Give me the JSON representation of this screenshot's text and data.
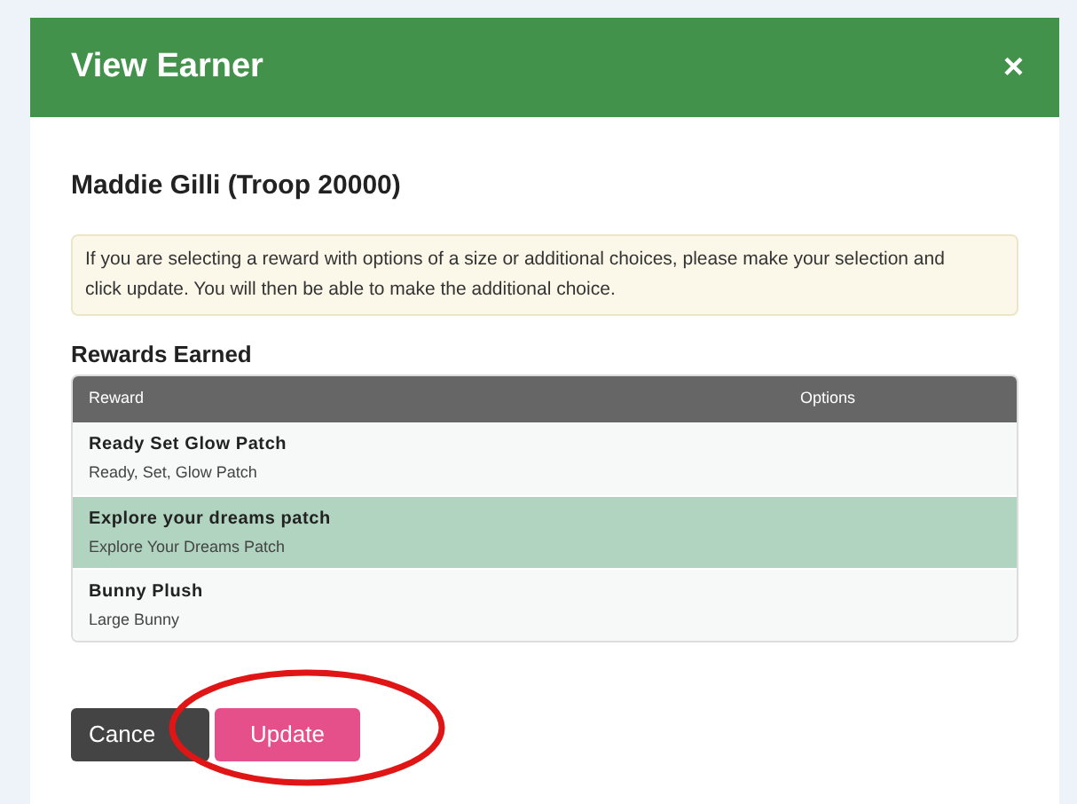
{
  "dialog": {
    "title": "View Earner",
    "close": "×"
  },
  "earner": "Maddie Gilli (Troop 20000)",
  "notice": "If you are selecting a reward with options of a size or additional choices, please make your selection and click update. You will then be able to make the additional choice.",
  "section_title": "Rewards Earned",
  "table": {
    "columns": [
      "Reward",
      "Options"
    ],
    "rows": [
      {
        "title": "Ready Set Glow Patch",
        "subtitle": "Ready, Set, Glow Patch",
        "selected": false
      },
      {
        "title": "Explore your dreams patch",
        "subtitle": "Explore Your Dreams Patch",
        "selected": true
      },
      {
        "title": "Bunny Plush",
        "subtitle": "Large Bunny",
        "selected": false
      }
    ]
  },
  "buttons": [
    {
      "label": "Cance",
      "kind": "cancel"
    },
    {
      "label": "Update",
      "kind": "primary"
    }
  ]
}
